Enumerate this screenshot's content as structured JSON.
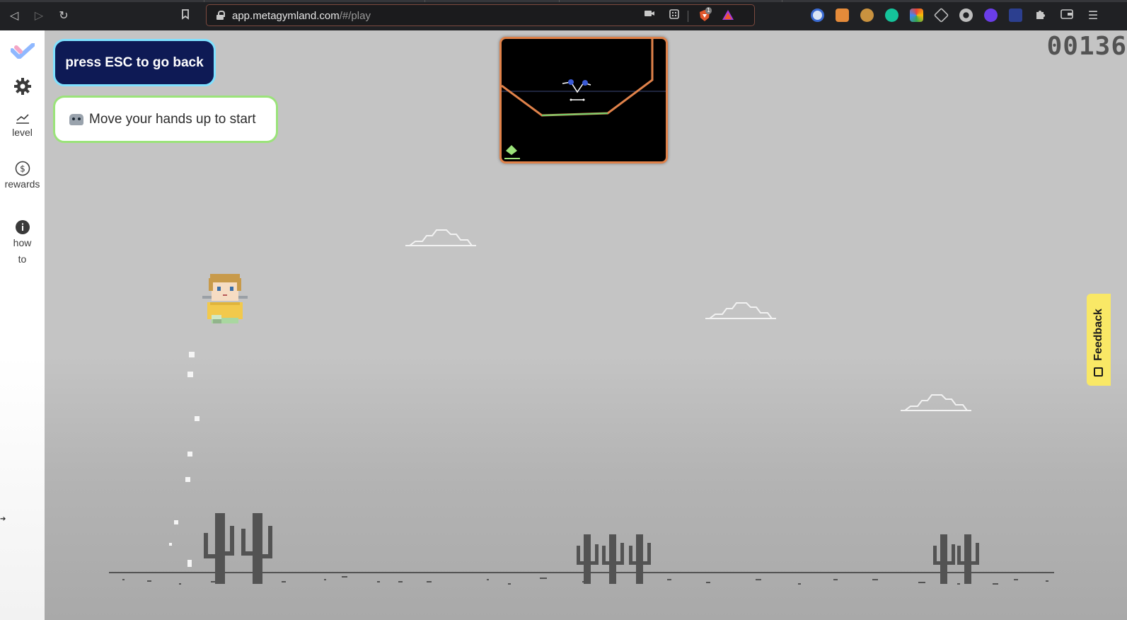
{
  "browser": {
    "url_host": "app.metagymland.com",
    "url_path": "/#/play",
    "shield_badge": "1"
  },
  "sidebar": {
    "items": [
      {
        "label": ""
      },
      {
        "label": ""
      },
      {
        "label": "level"
      },
      {
        "label": "rewards"
      },
      {
        "label_line1": "how",
        "label_line2": "to"
      }
    ]
  },
  "game": {
    "esc_button": "press ESC to go back",
    "hint_text": "Move your hands up to start",
    "score": "00136",
    "feedback_label": "Feedback"
  },
  "colors": {
    "esc_bg": "#0e1a55",
    "esc_border": "#7fe1ff",
    "hint_border": "#9be37a",
    "camera_border": "#e0824a",
    "feedback_bg": "#f9e866",
    "ground": "#535353"
  }
}
